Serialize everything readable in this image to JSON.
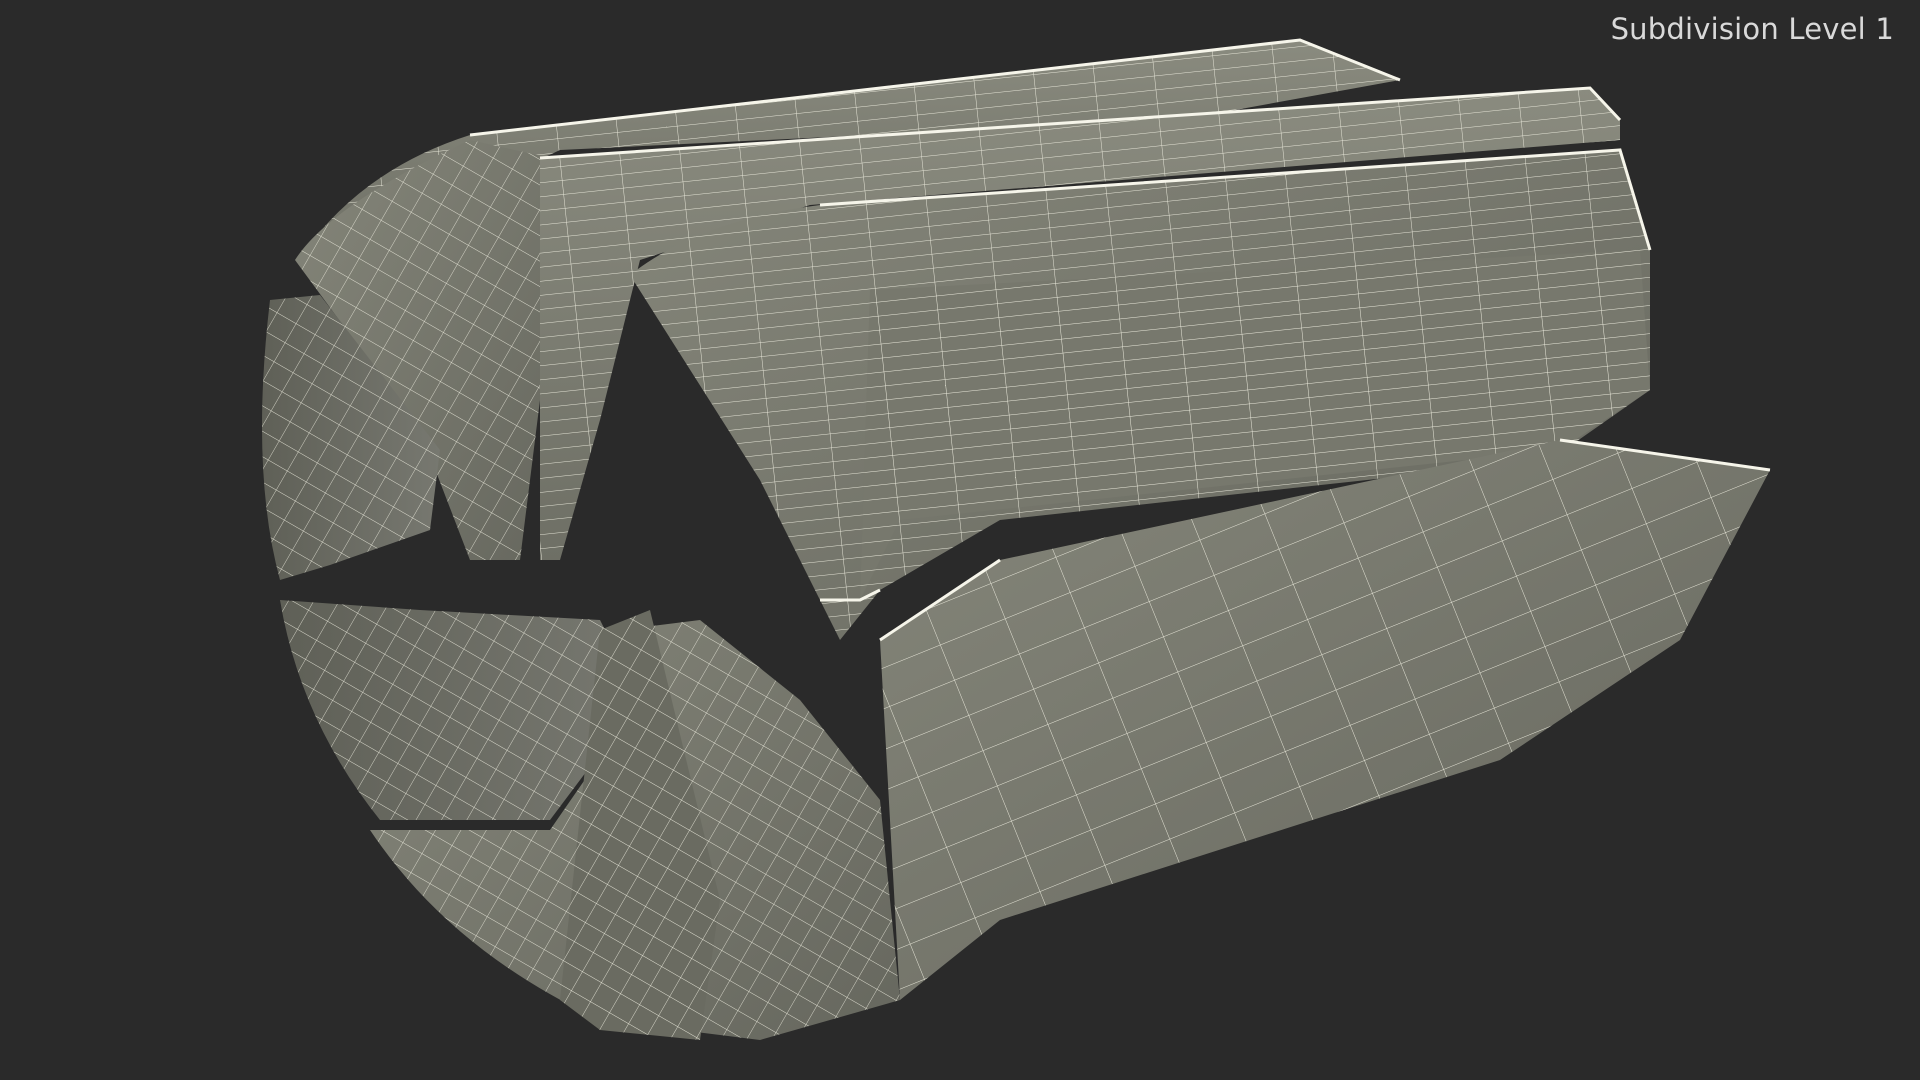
{
  "viewport": {
    "label": "Subdivision Level 1",
    "background_color": "#2a2a2a"
  },
  "model": {
    "subject": "segmented-cylinder-wireframe",
    "surface_color": "#7d7e72",
    "wire_color": "#f1f0e2",
    "shadow_color": "#5d5e55"
  }
}
